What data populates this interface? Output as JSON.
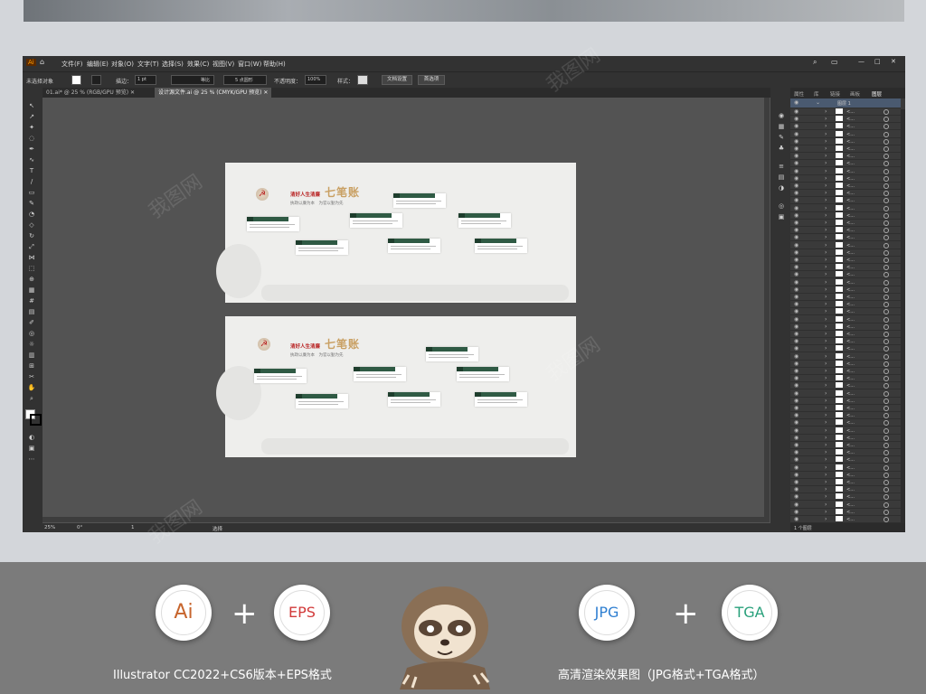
{
  "app": {
    "logo": "Ai",
    "menu": [
      "文件(F)",
      "编辑(E)",
      "对象(O)",
      "文字(T)",
      "选择(S)",
      "效果(C)",
      "视图(V)",
      "窗口(W)",
      "帮助(H)"
    ],
    "control": {
      "selection": "未选择对象",
      "stroke_label": "描边：",
      "stroke_value": "1 pt",
      "stroke_style": "等比",
      "brush": "5 点圆形",
      "opacity_label": "不透明度：",
      "opacity_value": "100%",
      "style_label": "样式：",
      "doc_setup": "文档设置",
      "prefs": "首选项"
    },
    "tabs": [
      {
        "label": "01.ai* @ 25 % (RGB/GPU 预览)"
      },
      {
        "label": "设计源文件.ai @ 25 % (CMYK/GPU 预览)"
      }
    ],
    "status": {
      "zoom": "25%",
      "rotation": "0°",
      "artboard": "1",
      "tool": "选择"
    },
    "layers_panel": {
      "tabs": [
        "属性",
        "库",
        "链接",
        "画板",
        "图层"
      ],
      "top_layer": "图层 1",
      "row_labels": [
        "<...",
        "<...",
        "<...",
        "<...",
        "<...",
        "<...",
        "<...",
        "<...",
        "<...",
        "<...",
        "<...",
        "<...",
        "<...",
        "<...",
        "<...",
        "<...",
        "<...",
        "<...",
        "<...",
        "<...",
        "<...",
        "<...",
        "<...",
        "<...",
        "<...",
        "<...",
        "<...",
        "<...",
        "<...",
        "<...",
        "<...",
        "<...",
        "<...",
        "<...",
        "<...",
        "<...",
        "<...",
        "<...",
        "<...",
        "<...",
        "<...",
        "<...",
        "<...",
        "<...",
        "<...",
        "<...",
        "<...",
        "<...",
        "<...",
        "<...",
        "<...",
        "<...",
        "<...",
        "<...",
        "<...",
        "<..."
      ],
      "footer": "1 个图层"
    }
  },
  "artboards": [
    {
      "title": "清好人生清廉",
      "big": "七笔账",
      "sub": "执政以廉为本　为官以勤为先"
    },
    {
      "title": "清好人生清廉",
      "big": "七笔账",
      "sub": "执政以廉为本　为官以勤为先"
    }
  ],
  "promo": {
    "formats": [
      "Ai",
      "EPS",
      "JPG",
      "TGA"
    ],
    "plus": "+",
    "caption_left": "Illustrator CC2022+CS6版本+EPS格式",
    "caption_right": "高清渲染效果图（JPG格式+TGA格式）"
  },
  "colors": {
    "ai": "#c7652d",
    "eps": "#d23b3b",
    "jpg": "#2f7fd1",
    "tga": "#2aa17c"
  }
}
